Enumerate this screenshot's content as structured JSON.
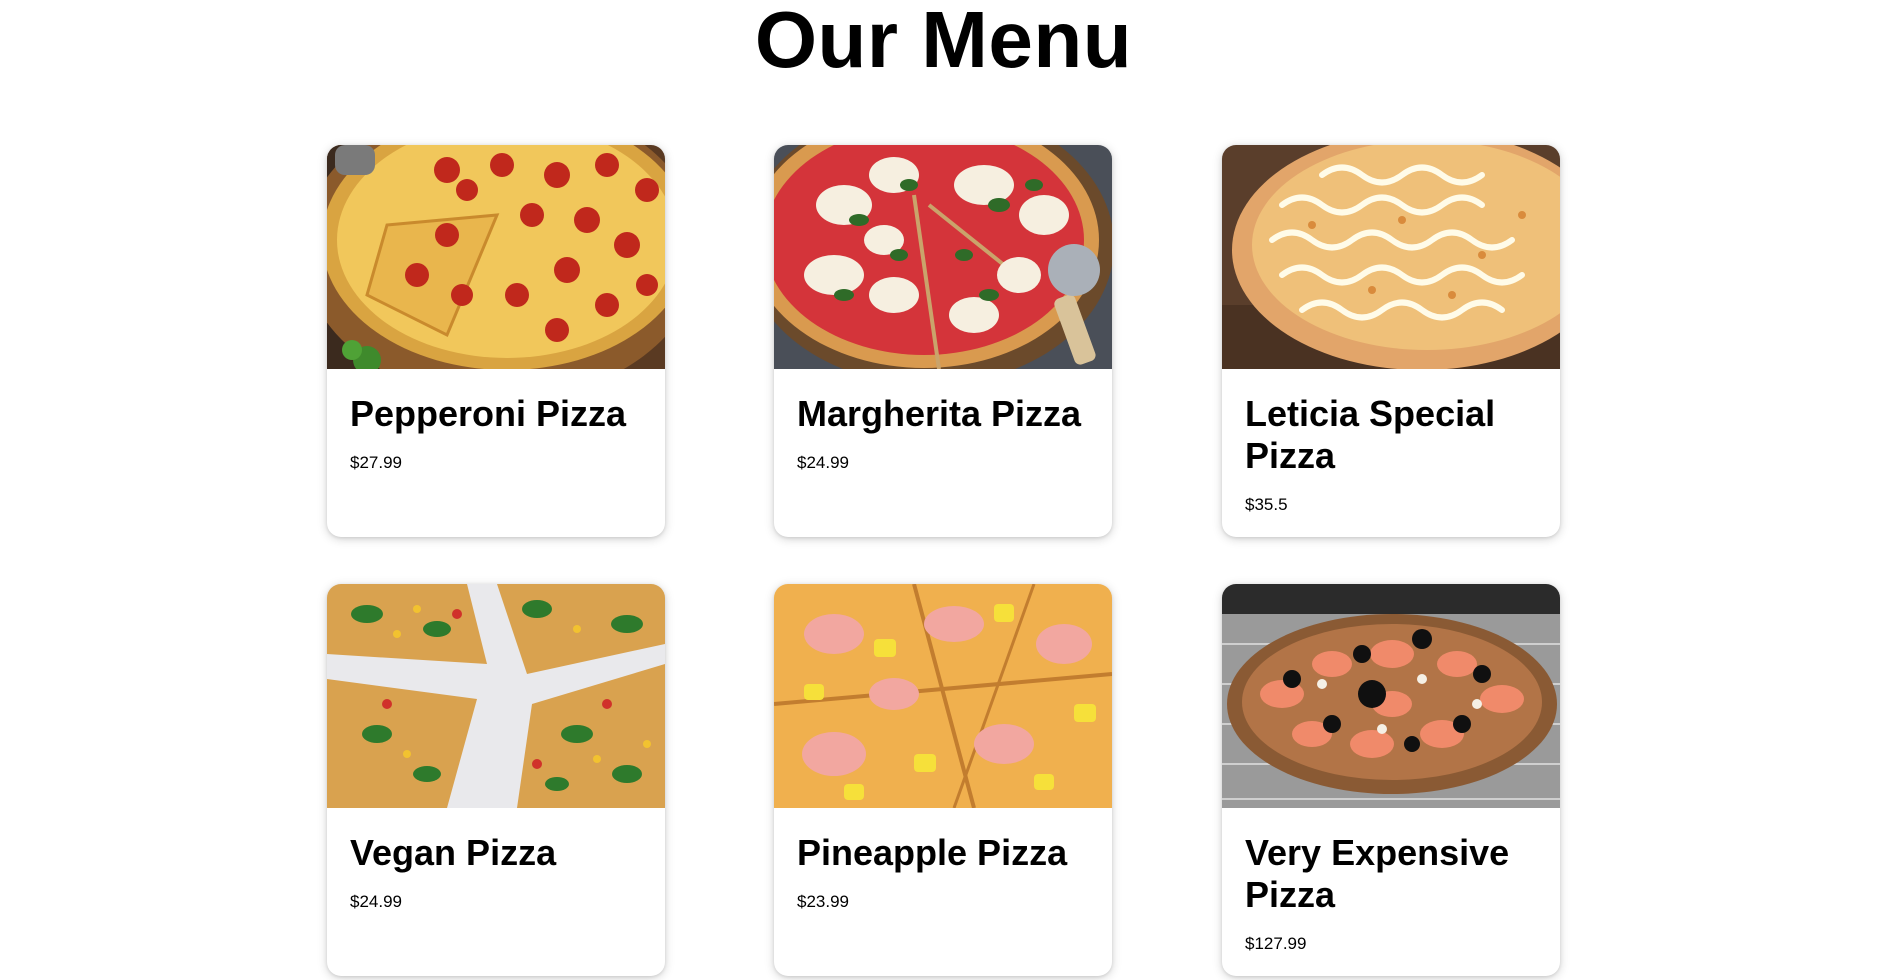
{
  "page": {
    "title": "Our Menu"
  },
  "menu": {
    "items": [
      {
        "name": "Pepperoni Pizza",
        "price": "$27.99",
        "image": "pepperoni-pizza-photo"
      },
      {
        "name": "Margherita Pizza",
        "price": "$24.99",
        "image": "margherita-pizza-photo"
      },
      {
        "name": "Leticia Special Pizza",
        "price": "$35.5",
        "image": "leticia-special-pizza-photo"
      },
      {
        "name": "Vegan Pizza",
        "price": "$24.99",
        "image": "vegan-pizza-photo"
      },
      {
        "name": "Pineapple Pizza",
        "price": "$23.99",
        "image": "pineapple-pizza-photo"
      },
      {
        "name": "Very Expensive Pizza",
        "price": "$127.99",
        "image": "very-expensive-pizza-photo"
      }
    ]
  },
  "colors": {
    "background": "#ffffff",
    "text": "#000000",
    "card_background": "#ffffff"
  }
}
